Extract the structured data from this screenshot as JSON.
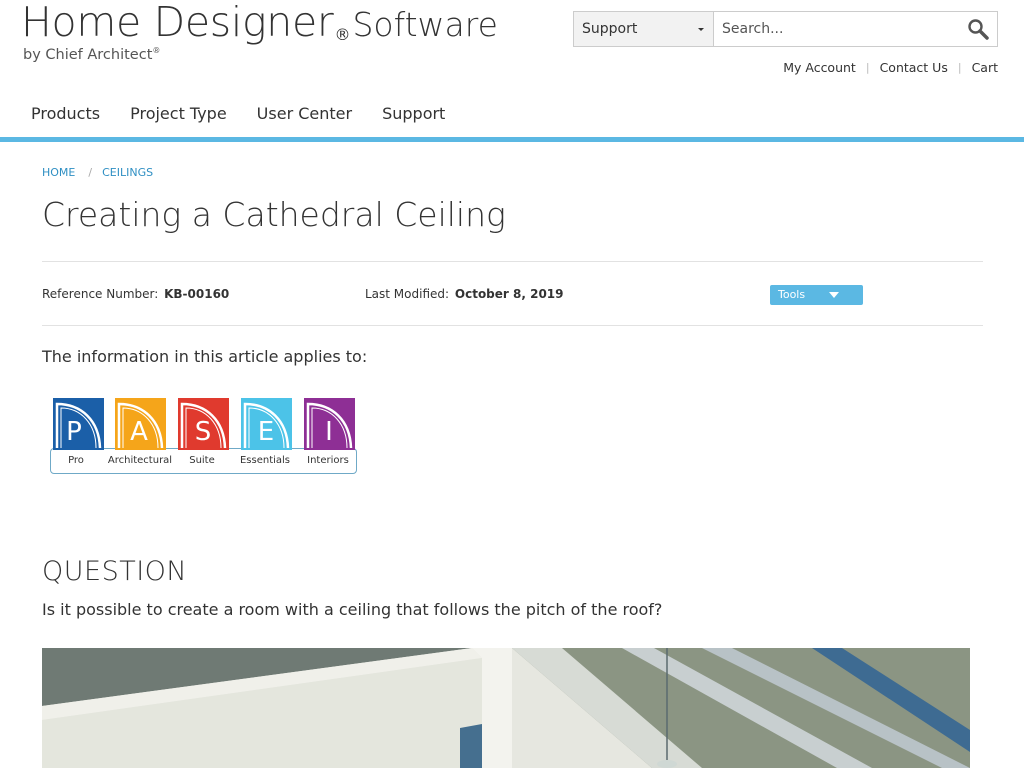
{
  "logo": {
    "main": "Home Designer",
    "reg": "®",
    "software": "Software",
    "by": "by Chief Architect",
    "by_reg": "®"
  },
  "search": {
    "category": "Support",
    "placeholder": "Search..."
  },
  "util_links": [
    "My Account",
    "Contact Us",
    "Cart"
  ],
  "nav": [
    "Products",
    "Project Type",
    "User Center",
    "Support"
  ],
  "breadcrumb": [
    "HOME",
    "CEILINGS"
  ],
  "article": {
    "title": "Creating a Cathedral Ceiling",
    "ref_label": "Reference Number:",
    "ref_value": "KB-00160",
    "mod_label": "Last Modified:",
    "mod_value": "October 8, 2019",
    "tools_label": "Tools",
    "applies_text": "The information in this article applies to:",
    "products": [
      {
        "letter": "P",
        "label": "Pro",
        "color": "#1b5fa8"
      },
      {
        "letter": "A",
        "label": "Architectural",
        "color": "#f5a51a"
      },
      {
        "letter": "S",
        "label": "Suite",
        "color": "#e03a2e"
      },
      {
        "letter": "E",
        "label": "Essentials",
        "color": "#4cc3e8"
      },
      {
        "letter": "I",
        "label": "Interiors",
        "color": "#8e2f95"
      }
    ],
    "question_heading": "QUESTION",
    "question_text": "Is it possible to create a room with a ceiling that follows the pitch of the roof?"
  },
  "colors": {
    "accent": "#5bb8e3",
    "link": "#2f8fc3"
  }
}
